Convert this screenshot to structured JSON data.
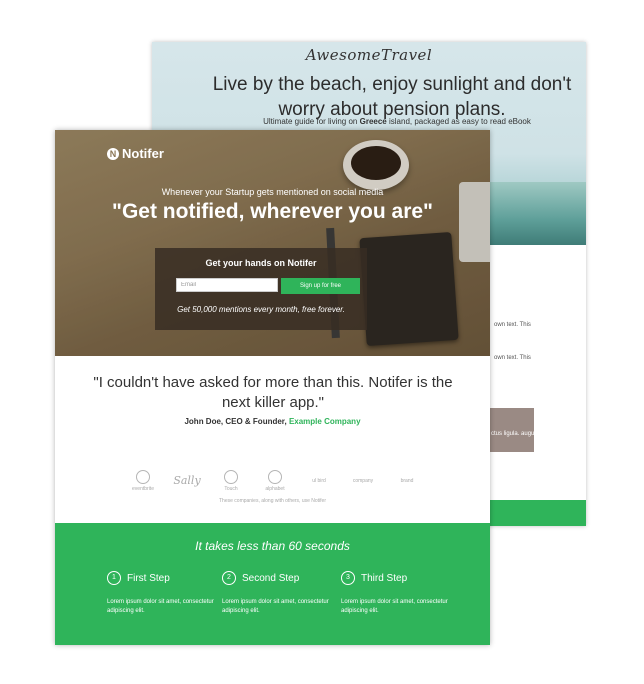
{
  "back_page": {
    "brand": "AwesomeTravel",
    "headline": "Live by the beach, enjoy sunlight and don't worry about pension plans.",
    "subtitle_before": "Ultimate guide for living on",
    "subtitle_bold": "Greece",
    "subtitle_after": "island, packaged as easy to read eBook",
    "side_text_1": "own text. This",
    "side_text_2": "own text. This",
    "image_caption": "ctus ligula. augue."
  },
  "front_page": {
    "logo_glyph": "N",
    "logo_text": "Notifer",
    "hero_pretitle": "Whenever your Startup gets mentioned on social media",
    "hero_title": "\"Get notified, wherever you are\"",
    "signup": {
      "title": "Get your hands on Notifer",
      "email_placeholder": "Email",
      "button_label": "Sign up for free",
      "note": "Get 50,000 mentions every month, free forever."
    },
    "quote": "\"I couldn't have asked for more than this. Notifer is the next killer app.\"",
    "attribution_name": "John Doe, CEO & Founder,",
    "attribution_company": "Example Company",
    "partner_logos": [
      "eventbrite",
      "Sally",
      "Touch",
      "alphabet",
      "ul bird",
      "company",
      "brand"
    ],
    "logos_caption": "These companies, along with others, use Notifer",
    "green_title": "It takes less than 60 seconds",
    "steps": [
      {
        "num": "1",
        "title": "First Step",
        "desc": "Lorem ipsum dolor sit amet, consectetur adipiscing elit."
      },
      {
        "num": "2",
        "title": "Second Step",
        "desc": "Lorem ipsum dolor sit amet, consectetur adipiscing elit."
      },
      {
        "num": "3",
        "title": "Third Step",
        "desc": "Lorem ipsum dolor sit amet, consectetur adipiscing elit."
      }
    ]
  },
  "colors": {
    "accent_green": "#2fb45a",
    "hero_wood": "#8c7756",
    "back_sky": "#cfe2e6"
  }
}
